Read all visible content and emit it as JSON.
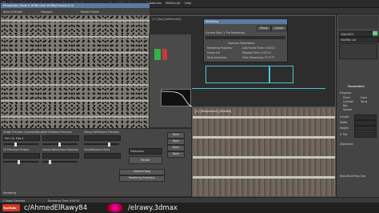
{
  "app": {
    "title": "Autodesk 3ds Max",
    "menu": [
      "File",
      "Edit",
      "Tools",
      "Group",
      "Views",
      "Create",
      "Modifiers",
      "Animation",
      "Graph Editors",
      "Rendering",
      "Customize",
      "MAXScript",
      "Help"
    ]
  },
  "frame_buffer": {
    "title": "Perspective, frame 0, RGBA Color 16 Bits/Channel (1:1)",
    "area": "Area to Render",
    "viewport": "Viewport:",
    "render_preset": "Render Preset:"
  },
  "render_setup": {
    "title": "Rendering",
    "image_precision_label": "Image Precision (Quality/Noise)",
    "soft_shadows_label": "Soft Shadows Precision",
    "glossy_label": "Glossy Reflections Precision",
    "glossy_refr_label": "Glossy Refractions Precision",
    "trace_label": "Trace/Bounce Limits",
    "final_gather_label": "FG Precision Presets",
    "quality_value": "Min 1/4, Max 4",
    "production": "Production",
    "render_button": "Render",
    "none_labels": [
      "None",
      "None",
      "None",
      "None"
    ],
    "general_help": "General Help",
    "rendering_summary": "Rendering Summary"
  },
  "progress_dialog": {
    "title": "Rendering",
    "pause": "Pause",
    "cancel": "Cancel",
    "current_task_label": "Current Task:",
    "current_task_value": "1. Pre Rendering...",
    "common_params": "Common Parameters",
    "rendering_progress": "Rendering Progress:",
    "frame_label": "Frame #",
    "frame_value": "0",
    "last_frame": "Last Frame Time: 0:00:10",
    "elapsed": "Elapsed Time: 0:00:10",
    "total_label": "Total Animation",
    "time_remaining": "Time Remaining: ??:??:??"
  },
  "viewports": {
    "perspective_label": "[+] [Perspective] [Shaded]",
    "top_label": "[+] [Top] [Wireframe]"
  },
  "command_panel": {
    "title": "Parameters",
    "object_name": "Object001",
    "modifier_list": "Modifier List",
    "items": [
      "Plane",
      "Cylinder",
      "Box",
      "Sphere",
      "Cone",
      "Torus"
    ],
    "mapping_label": "Mapping:",
    "length_label": "Length:",
    "width_label": "Width:",
    "height_label": "Height:",
    "uv_label": "U Tile:",
    "alignment_label": "Alignment:",
    "real_world": "Real-World Map Size"
  },
  "status": {
    "selection": "1 Object Selected",
    "hint": "Rendering Time: 0:00:10"
  },
  "footer": {
    "youtube_handle": "c/AhmedElRawy84",
    "insta_handle": "/elrawy.3dmax",
    "youtube_label": "YouTube"
  },
  "colors": {
    "accent_green": "#2fb34a",
    "mortar": "#c7c7c0",
    "brick": "#6b6158"
  }
}
